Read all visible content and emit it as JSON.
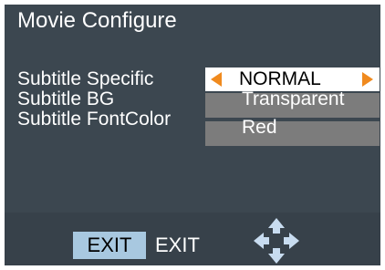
{
  "menu": {
    "title": "Movie Configure",
    "rows": [
      {
        "label": "Subtitle Specific",
        "value": "NORMAL"
      },
      {
        "label": "Subtitle BG",
        "value": "Transparent"
      },
      {
        "label": "Subtitle FontColor",
        "value": "Red"
      }
    ]
  },
  "footer": {
    "exit_key": "EXIT",
    "exit_text": "EXIT",
    "nav_icon": "dpad-arrows-icon"
  },
  "colors": {
    "background": "#3c4750",
    "selected_row": "#ffffff",
    "row": "#7c7c7c",
    "arrow": "#f08a1e",
    "exit_key": "#a8c8e0"
  }
}
